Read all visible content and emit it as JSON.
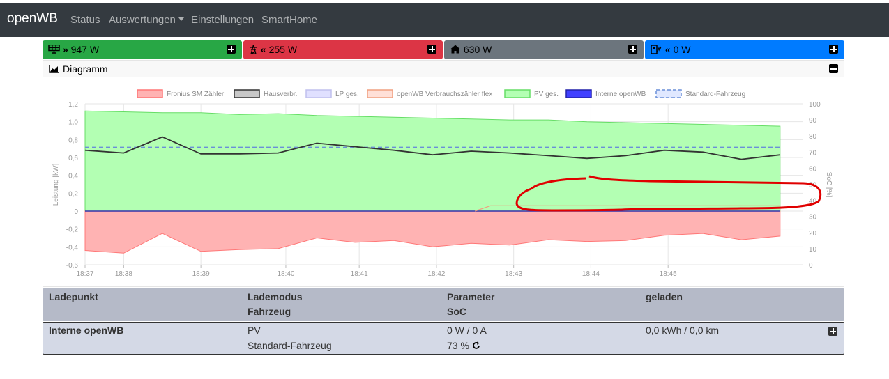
{
  "brand": "openWB",
  "nav": {
    "status": "Status",
    "auswertungen": "Auswertungen",
    "einstellungen": "Einstellungen",
    "smarthome": "SmartHome"
  },
  "stats": {
    "pv": "947 W",
    "evu": "255 W",
    "house": "630 W",
    "battery": "0 W"
  },
  "colors": {
    "pv": "#28a745",
    "evu": "#dc3545",
    "house": "#6c757d",
    "battery": "#007bff",
    "annotation": "#e00000"
  },
  "diagram": {
    "title": "Diagramm"
  },
  "chart_data": {
    "type": "area",
    "legend": [
      "Fronius SM Zähler",
      "Hausverbr.",
      "LP ges.",
      "openWB Verbrauchszähler flex",
      "PV ges.",
      "Interne openWB",
      "Standard-Fahrzeug"
    ],
    "ylabel": "Leistung [kW]",
    "y2label": "SoC [%]",
    "ylim": [
      -0.6,
      1.2
    ],
    "y2lim": [
      0,
      100
    ],
    "yticks": [
      "1,2",
      "1,0",
      "0,8",
      "0,6",
      "0,4",
      "0,2",
      "0",
      "-0,2",
      "-0,4",
      "-0,6"
    ],
    "y2ticks": [
      "100",
      "90",
      "80",
      "70",
      "60",
      "50",
      "40",
      "30",
      "20",
      "10",
      "0"
    ],
    "xticks": [
      "18:37",
      "18:38",
      "18:39",
      "18:40",
      "18:41",
      "18:42",
      "18:43",
      "18:44",
      "18:45"
    ],
    "x_minutes": [
      0,
      0.5,
      1,
      1.5,
      2,
      2.5,
      3,
      3.5,
      4,
      4.5,
      5,
      5.5,
      6,
      6.5,
      7,
      7.5,
      8,
      8.5,
      9
    ],
    "series": [
      {
        "name": "PV ges.",
        "values": [
          1.12,
          1.11,
          1.1,
          1.1,
          1.08,
          1.09,
          1.07,
          1.06,
          1.05,
          1.04,
          1.03,
          1.02,
          1.02,
          1.0,
          0.99,
          0.98,
          0.97,
          0.96,
          0.95
        ]
      },
      {
        "name": "Hausverbr.",
        "values": [
          0.68,
          0.65,
          0.83,
          0.64,
          0.64,
          0.65,
          0.76,
          0.72,
          0.68,
          0.63,
          0.67,
          0.65,
          0.62,
          0.59,
          0.62,
          0.68,
          0.66,
          0.58,
          0.63
        ]
      },
      {
        "name": "Fronius SM Zähler",
        "values": [
          -0.44,
          -0.47,
          -0.25,
          -0.45,
          -0.43,
          -0.42,
          -0.3,
          -0.35,
          -0.33,
          -0.4,
          -0.36,
          -0.38,
          -0.32,
          -0.34,
          -0.33,
          -0.27,
          -0.25,
          -0.32,
          -0.28
        ]
      },
      {
        "name": "Standard-Fahrzeug",
        "values": [
          73,
          73,
          73,
          73,
          73,
          73,
          73,
          73,
          73,
          73,
          73,
          73,
          73,
          73,
          73,
          73,
          73,
          73,
          73
        ]
      },
      {
        "name": "Interne openWB",
        "values": [
          0,
          0,
          0,
          0,
          0,
          0,
          0,
          0,
          0,
          0,
          0,
          0,
          0,
          0,
          0,
          0,
          0,
          0,
          0
        ]
      }
    ]
  },
  "table": {
    "headers": {
      "ladepunkt": "Ladepunkt",
      "lademodus": "Lademodus",
      "fahrzeug": "Fahrzeug",
      "parameter": "Parameter",
      "soc": "SoC",
      "geladen": "geladen"
    },
    "row": {
      "name": "Interne openWB",
      "mode": "PV",
      "vehicle": "Standard-Fahrzeug",
      "param": "0 W / 0 A",
      "soc": "73 %",
      "charged": "0,0 kWh / 0,0 km"
    }
  }
}
